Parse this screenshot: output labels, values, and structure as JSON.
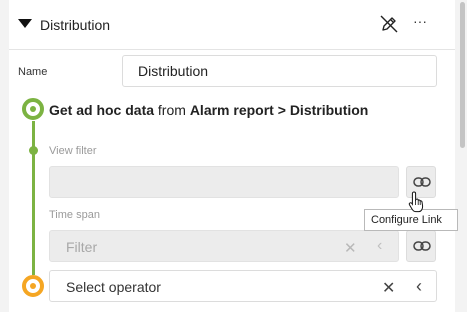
{
  "header": {
    "title": "Distribution",
    "collapse_icon": "triangle-down-icon",
    "edit_icon": "pencil-off-icon",
    "more_label": "···"
  },
  "name_field": {
    "label": "Name",
    "value": "Distribution"
  },
  "step": {
    "action": "Get ad hoc data",
    "from_word": "from",
    "source": "Alarm report",
    "separator": ">",
    "target": "Distribution"
  },
  "view_filter": {
    "label": "View filter",
    "value": ""
  },
  "time_span": {
    "label": "Time span",
    "placeholder": "Filter"
  },
  "tooltip": "Configure Link",
  "operator": {
    "placeholder": "Select operator"
  },
  "colors": {
    "rail_green": "#7cb342",
    "node_orange": "#f5a623"
  },
  "icons": {
    "link": "link-icon",
    "clear": "close-icon",
    "chevron": "chevron-left-icon",
    "cursor": "hand-pointer-icon"
  },
  "glyphs": {
    "clear": "✕",
    "chevron": "‹"
  }
}
